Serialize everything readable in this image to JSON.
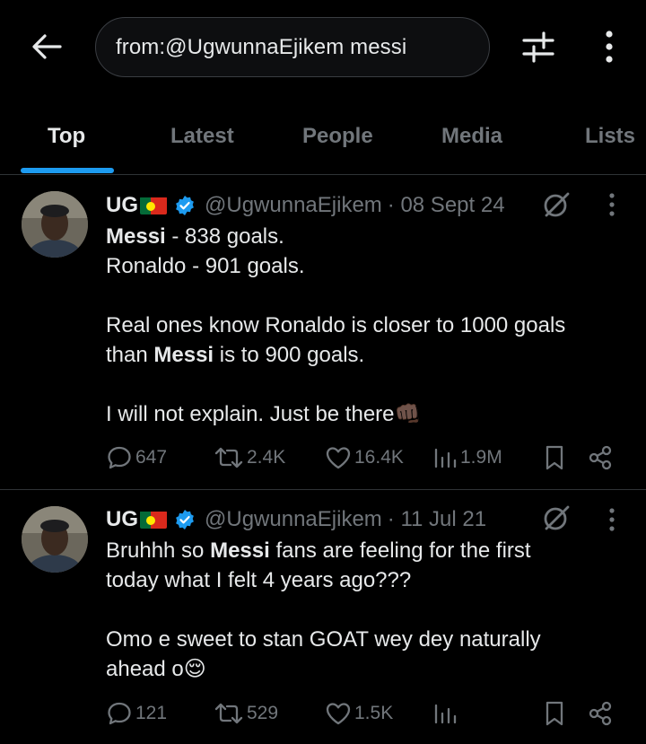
{
  "search": {
    "query": "from:@UgwunnaEjikem messi"
  },
  "tabs": [
    "Top",
    "Latest",
    "People",
    "Media",
    "Lists"
  ],
  "tweets": [
    {
      "name": "UG",
      "handle": "@UgwunnaEjikem",
      "date": "· 08 Sept 24",
      "lines": [
        [
          "Messi",
          " - 838 goals."
        ],
        [
          "Ronaldo - 901 goals."
        ],
        [
          ""
        ],
        [
          "Real ones know Ronaldo is closer to 1000 goals"
        ],
        [
          "than ",
          "Messi",
          " is to 900 goals."
        ],
        [
          ""
        ],
        [
          "I will not explain. Just be there👊🏿"
        ]
      ],
      "replies": "647",
      "reposts": "2.4K",
      "likes": "16.4K",
      "views": "1.9M"
    },
    {
      "name": "UG",
      "handle": "@UgwunnaEjikem",
      "date": "· 11 Jul 21",
      "lines": [
        [
          "Bruhhh so ",
          "Messi",
          " fans are feeling for the first"
        ],
        [
          "today what I felt 4 years ago???"
        ],
        [
          ""
        ],
        [
          "Omo e sweet to stan GOAT wey dey naturally"
        ],
        [
          "ahead o😌"
        ]
      ],
      "replies": "121",
      "reposts": "529",
      "likes": "1.5K",
      "views": ""
    }
  ],
  "colors": {
    "accent": "#1d9bf0",
    "muted": "#71767b",
    "text": "#e7e9ea",
    "background": "#000000"
  }
}
